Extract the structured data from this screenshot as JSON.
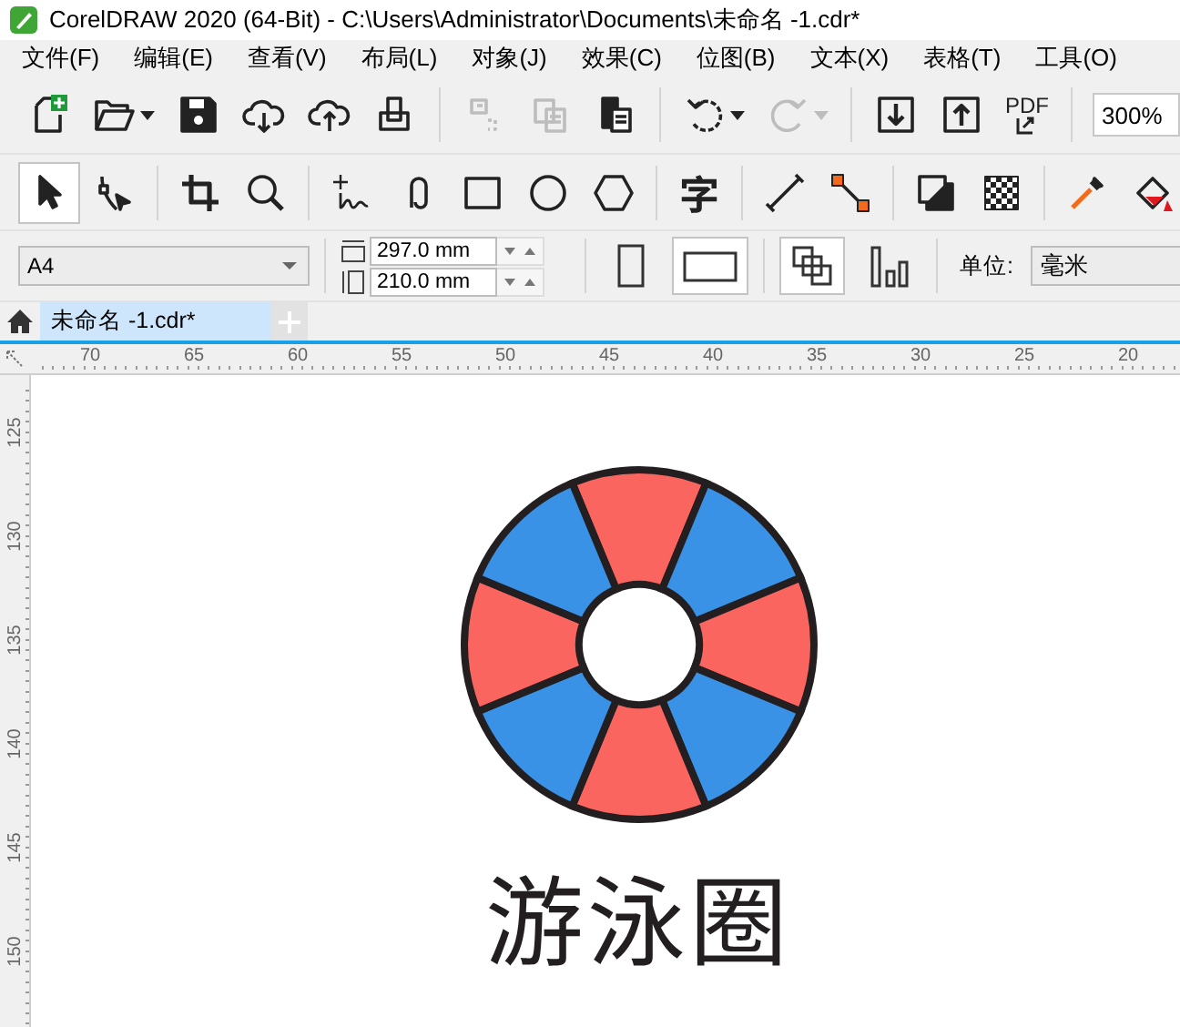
{
  "window": {
    "title": "CorelDRAW 2020 (64-Bit) - C:\\Users\\Administrator\\Documents\\未命名 -1.cdr*"
  },
  "menu": [
    "文件(F)",
    "编辑(E)",
    "查看(V)",
    "布局(L)",
    "对象(J)",
    "效果(C)",
    "位图(B)",
    "文本(X)",
    "表格(T)",
    "工具(O)"
  ],
  "standard_toolbar": {
    "buttons": [
      {
        "disabled": false
      },
      {
        "disabled": false
      },
      {
        "disabled": false
      },
      {
        "disabled": false
      },
      {
        "disabled": false
      },
      {
        "disabled": false
      },
      {
        "disabled": true
      },
      {
        "disabled": true
      },
      {
        "disabled": false
      },
      {
        "disabled": false
      },
      {
        "disabled": true
      },
      {
        "disabled": false
      },
      {
        "disabled": false
      },
      {
        "disabled": false
      }
    ],
    "pdf_label": "PDF",
    "zoom": "300%"
  },
  "toolbox": {
    "tools": [
      {
        "selected": true
      },
      {
        "selected": false
      },
      {
        "selected": false
      },
      {
        "selected": false
      },
      {
        "selected": false
      },
      {
        "selected": false
      },
      {
        "selected": false
      },
      {
        "selected": false
      },
      {
        "selected": false
      },
      {
        "selected": false,
        "glyph": "字"
      },
      {
        "selected": false
      },
      {
        "selected": false
      },
      {
        "selected": false
      },
      {
        "selected": false
      },
      {
        "selected": false
      },
      {
        "selected": false
      }
    ]
  },
  "property_bar": {
    "page_size": "A4",
    "width": "297.0 mm",
    "height": "210.0 mm",
    "orientations": [
      {
        "selected": false
      },
      {
        "selected": true
      }
    ],
    "page_modes": [
      {
        "selected": true
      },
      {
        "selected": false
      }
    ],
    "unit_label": "单位:",
    "unit": "毫米"
  },
  "tabs": [
    {
      "label": "未命名 -1.cdr*",
      "selected": true
    }
  ],
  "rulers": {
    "horizontal": [
      "70",
      "65",
      "60",
      "55",
      "50",
      "45",
      "40",
      "35",
      "30",
      "25",
      "20"
    ],
    "vertical": [
      "125",
      "130",
      "135",
      "140",
      "145",
      "150"
    ]
  },
  "canvas": {
    "caption": "游泳圈"
  }
}
